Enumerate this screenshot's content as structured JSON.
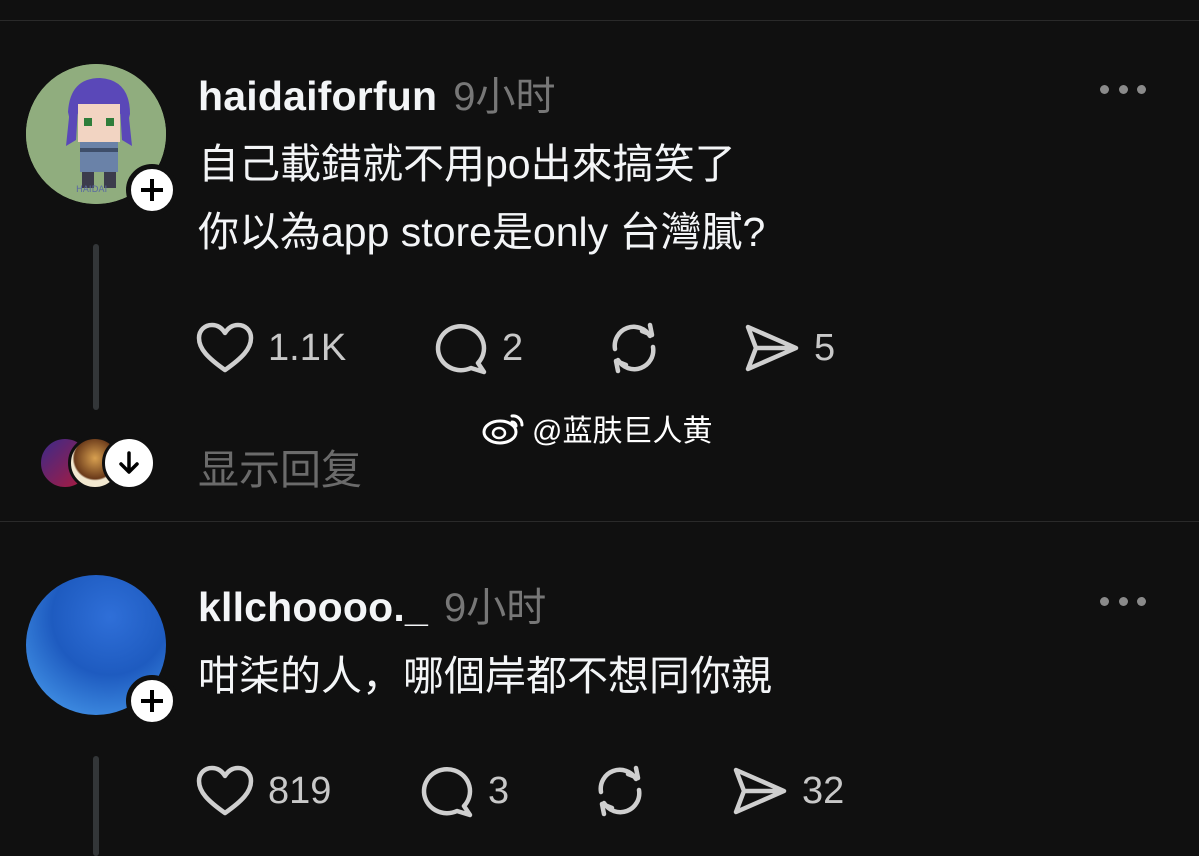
{
  "posts": [
    {
      "username": "haidaiforfun",
      "time": "9小时",
      "lines": [
        "自己載錯就不用po出來搞笑了",
        "你以為app store是only 台灣膩?"
      ],
      "likes": "1.1K",
      "comments": "2",
      "shares": "5",
      "avatar_text": "HAIDAI"
    },
    {
      "username": "kllchoooo._",
      "time": "9小时",
      "lines": [
        "咁柒的人，哪個岸都不想同你親"
      ],
      "likes": "819",
      "comments": "3",
      "shares": "32"
    }
  ],
  "show_replies_label": "显示回复",
  "watermark": "@蓝肤巨人黄",
  "icons": {
    "follow": "plus-icon",
    "more": "more-icon",
    "like": "heart-icon",
    "comment": "comment-icon",
    "repost": "repost-icon",
    "share": "send-icon",
    "expand": "arrow-down-icon",
    "weibo": "weibo-icon"
  },
  "colors": {
    "background": "#101010",
    "text": "#f3f5f7",
    "muted": "#777777",
    "divider": "#2a2a2a"
  }
}
